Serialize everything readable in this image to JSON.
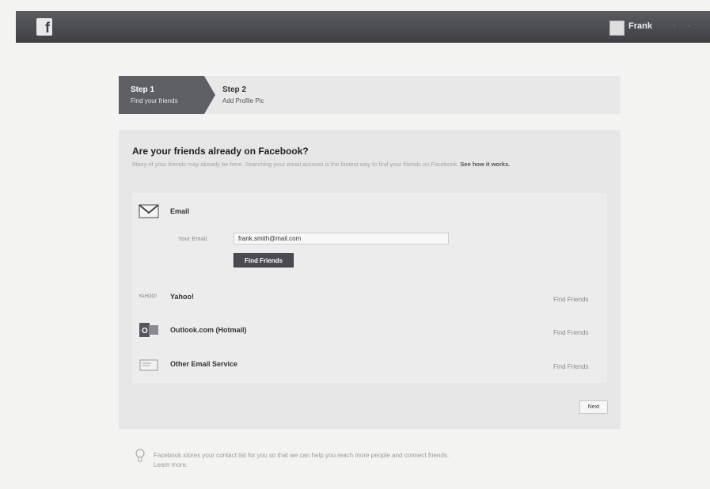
{
  "topbar": {
    "logo_letter": "f",
    "user_name": "Frank",
    "extra": "· ·"
  },
  "steps": {
    "step1_title": "Step 1",
    "step1_subtitle": "Find your friends",
    "step2_title": "Step 2",
    "step2_subtitle": "Add Profile Pic"
  },
  "panel": {
    "title": "Are your friends already on Facebook?",
    "description": "Many of your friends may already be here. Searching your email account is the fastest way to find your friends on Facebook.",
    "description_link": "See how it works.",
    "email_service": {
      "name": "Email",
      "email_label": "Your Email:",
      "email_value": "frank.smith@mail.com",
      "find_button": "Find Friends"
    },
    "providers": [
      {
        "icon": "yahoo-logo-icon",
        "name": "Yahoo!",
        "link": "Find Friends"
      },
      {
        "icon": "outlook-icon",
        "name": "Outlook.com (Hotmail)",
        "link": "Find Friends"
      },
      {
        "icon": "envelope-icon",
        "name": "Other Email Service",
        "link": "Find Friends"
      }
    ],
    "next_button": "Next"
  },
  "hint": {
    "text": "Facebook stores your contact list for you so that we can help you reach more people and connect friends.",
    "link": "Learn more."
  },
  "colors": {
    "topbar": "#4a4b51",
    "step_active": "#5e5f64",
    "button_dark": "#4a4b52"
  }
}
